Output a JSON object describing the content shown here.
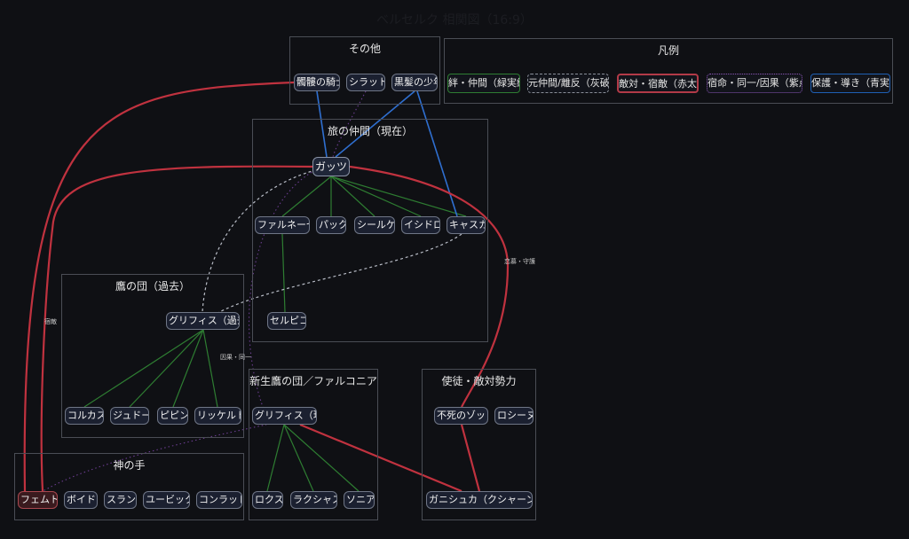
{
  "title": "ベルセルク 相関図（16:9）",
  "groups": {
    "other": "その他",
    "legend": "凡例",
    "companions": "旅の仲間（現在）",
    "hawks_past": "鷹の団（過去）",
    "new_hawks": "新生鷹の団／ファルコニア",
    "apostles": "使徒・敵対勢力",
    "godhand": "神の手"
  },
  "legend": [
    {
      "label": "絆・仲間（緑実線）",
      "color": "#2e7d32"
    },
    {
      "label": "元仲間/離反（灰破線）",
      "color": "#8a8f99"
    },
    {
      "label": "敵対・宿敵（赤太線）",
      "color": "#b23a48"
    },
    {
      "label": "宿命・同一/因果（紫点線）",
      "color": "#6a3d8f"
    },
    {
      "label": "保護・導き（青実線）",
      "color": "#1f5fb4"
    }
  ],
  "nodes": {
    "skull_knight": "髑髏の騎士",
    "schierke_sp": "シラット",
    "boy": "黒髪の少年",
    "guts": "ガッツ",
    "farnese": "ファルネーゼ",
    "puck": "パック",
    "schierke": "シールケ",
    "isidro": "イシドロ",
    "casca": "キャスカ",
    "serpico": "セルピコ",
    "griffith_past": "グリフィス（過去）",
    "corkus": "コルカス",
    "judeau": "ジュドー",
    "pippin": "ピピン",
    "rickert": "リッケルト",
    "griffith_now": "グリフィス（現）",
    "locus": "ロクス",
    "rakshas": "ラクシャス",
    "sonia": "ソニア",
    "zodd": "不死のゾッド",
    "rosine": "ロシーヌ",
    "ganishka": "ガニシュカ（クシャーン皇帝）",
    "femto": "フェムト",
    "void": "ボイド",
    "slan": "スラン",
    "ubik": "ユービック",
    "conrad": "コンラッド"
  },
  "edge_labels": {
    "kasca_guts": "恋慕・守護",
    "femto_guts": "宿敵",
    "griffith_link": "因果・同一"
  }
}
